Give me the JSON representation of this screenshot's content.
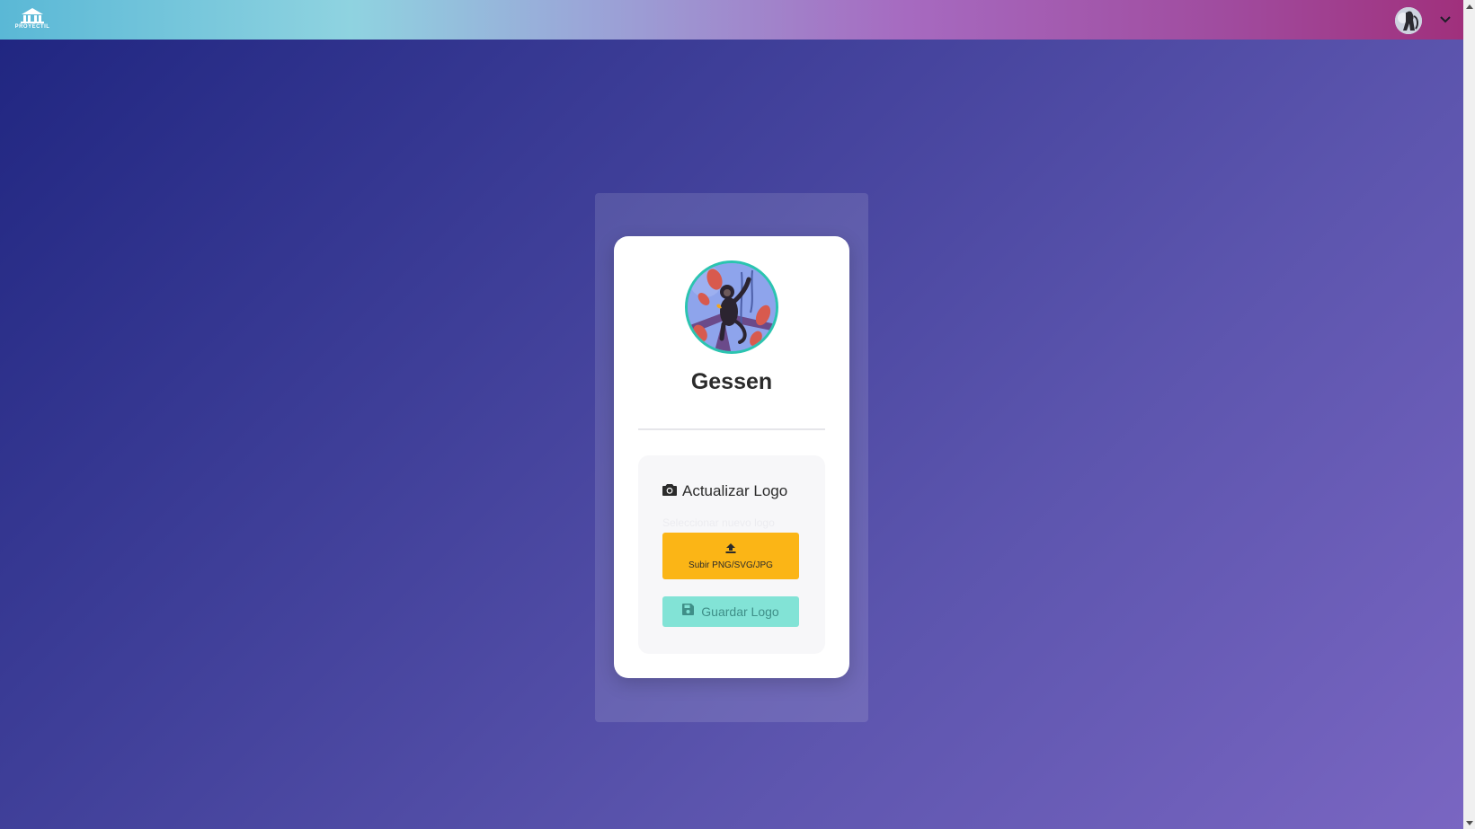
{
  "header": {
    "brand_text": "PROYECTIL",
    "user_menu_icon": "chevron-down-icon"
  },
  "company": {
    "name": "Gessen"
  },
  "logo_section": {
    "title": "Actualizar Logo",
    "title_icon": "camera-icon",
    "hint_text": "Seleccionar nuevo logo",
    "upload_label": "Subir PNG/SVG/JPG",
    "upload_icon": "upload-icon",
    "save_label": "Guardar Logo",
    "save_icon": "save-icon"
  },
  "colors": {
    "upload_button": "#fbb516",
    "save_button": "#82e3d6",
    "avatar_ring": "#2bc4b0"
  }
}
